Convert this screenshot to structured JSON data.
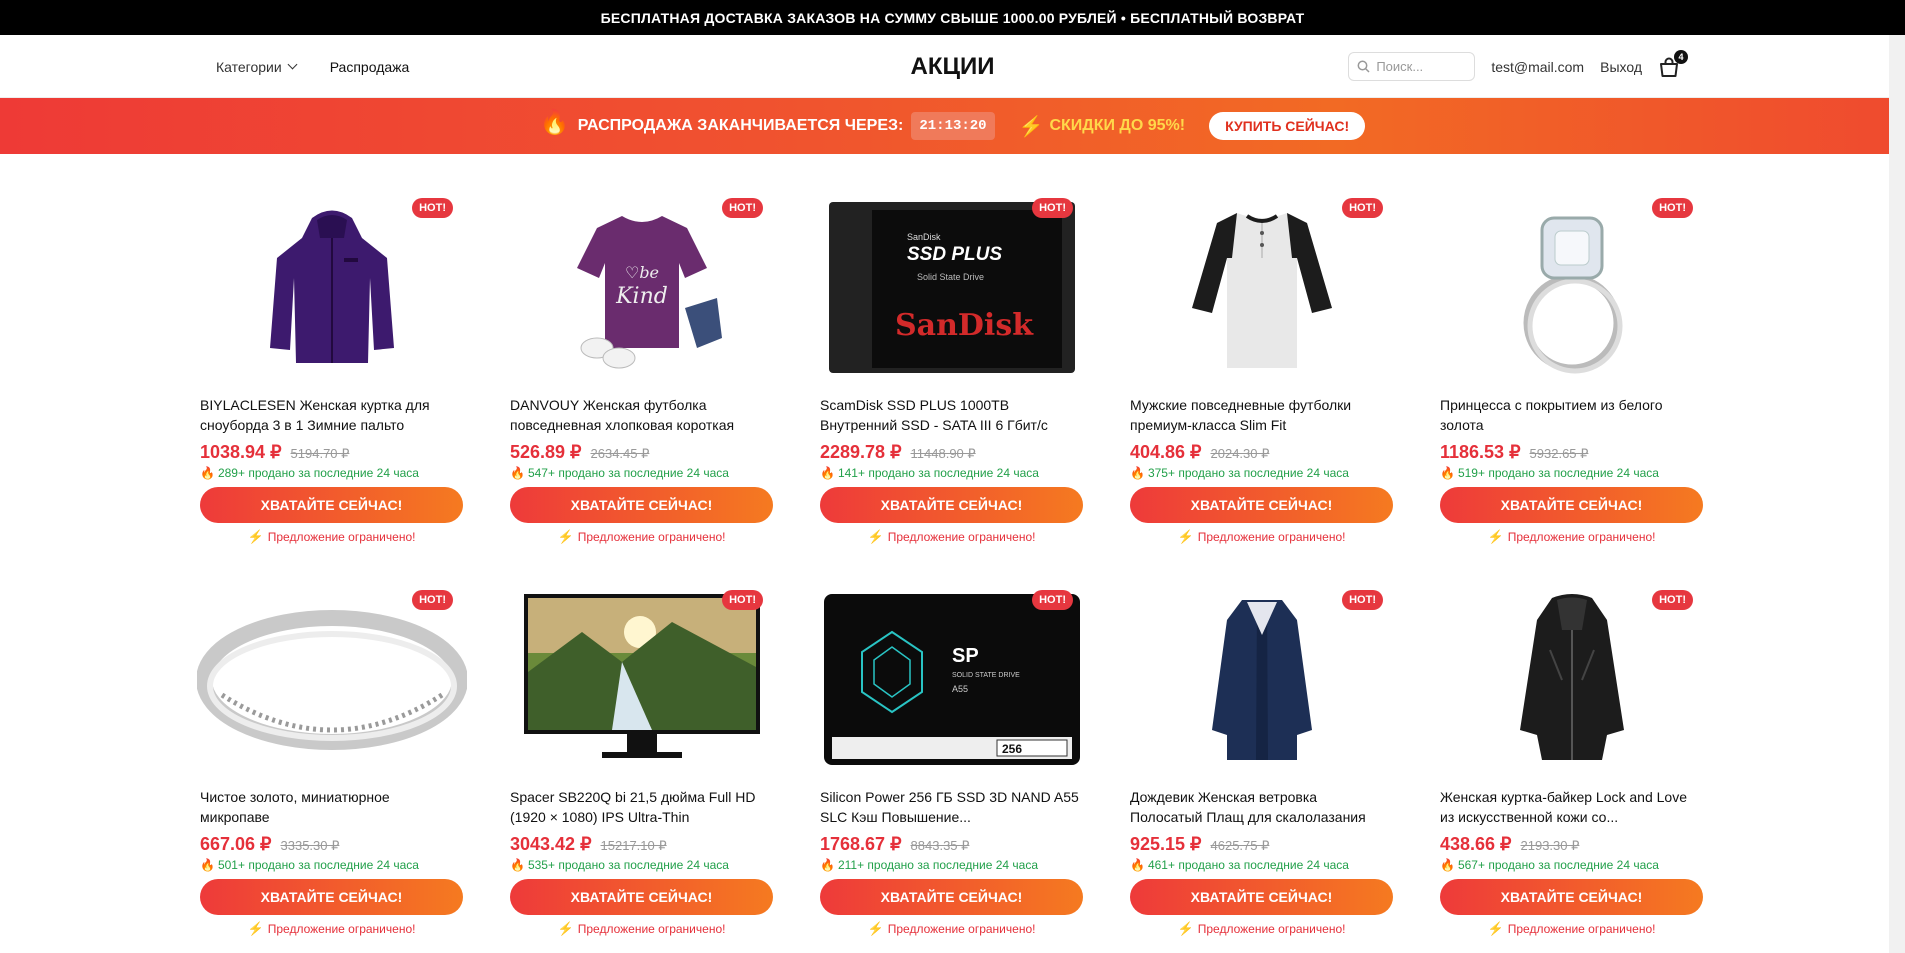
{
  "topbar": {
    "text": "БЕСПЛАТНАЯ ДОСТАВКА ЗАКАЗОВ НА СУММУ СВЫШЕ 1000.00 РУБЛЕЙ • БЕСПЛАТНЫЙ ВОЗВРАТ"
  },
  "header": {
    "categories_label": "Категории",
    "sale_label": "Распродажа",
    "title": "АКЦИИ",
    "search_placeholder": "Поиск...",
    "user_email": "test@mail.com",
    "logout_label": "Выход",
    "cart_count": "4"
  },
  "promo": {
    "fire_icon": "🔥",
    "ends_label": "РАСПРОДАЖА ЗАКАНЧИВАЕТСЯ ЧЕРЕЗ:",
    "timer": "21:13:20",
    "bolt_icon": "⚡",
    "discount_label": "СКИДКИ ДО 95%!",
    "buy_label": "КУПИТЬ СЕЙЧАС!"
  },
  "labels": {
    "hot": "HOT!",
    "grab": "ХВАТАЙТЕ СЕЙЧАС!",
    "limited": "Предложение ограничено!"
  },
  "colors": {
    "accent_red": "#e5303a",
    "accent_orange": "#f57a20",
    "sold_green": "#22a04a"
  },
  "products": [
    {
      "name": "BIYLACLESEN Женская куртка для сноуборда 3 в 1 Зимние пальто",
      "price": "1038.94 ₽",
      "old_price": "5194.70 ₽",
      "sold": "289+ продано за последние 24 часа",
      "image": "purple-jacket"
    },
    {
      "name": "DANVOUY Женская футболка повседневная хлопковая короткая",
      "price": "526.89 ₽",
      "old_price": "2634.45 ₽",
      "sold": "547+ продано за последние 24 часа",
      "image": "purple-tshirt"
    },
    {
      "name": "ScamDisk SSD PLUS 1000TB Внутренний SSD - SATA III 6 Гбит/с",
      "price": "2289.78 ₽",
      "old_price": "11448.90 ₽",
      "sold": "141+ продано за последние 24 часа",
      "image": "sandisk-ssd"
    },
    {
      "name": "Мужские повседневные футболки премиум-класса Slim Fit",
      "price": "404.86 ₽",
      "old_price": "2024.30 ₽",
      "sold": "375+ продано за последние 24 часа",
      "image": "raglan-shirt"
    },
    {
      "name": "Принцесса с покрытием из белого золота",
      "price": "1186.53 ₽",
      "old_price": "5932.65 ₽",
      "sold": "519+ продано за последние 24 часа",
      "image": "diamond-ring"
    },
    {
      "name": "Чистое золото, миниатюрное микропаве",
      "price": "667.06 ₽",
      "old_price": "3335.30 ₽",
      "sold": "501+ продано за последние 24 часа",
      "image": "silver-band"
    },
    {
      "name": "Spacer SB220Q bi 21,5 дюйма Full HD (1920 × 1080) IPS Ultra-Thin",
      "price": "3043.42 ₽",
      "old_price": "15217.10 ₽",
      "sold": "535+ продано за последние 24 часа",
      "image": "monitor"
    },
    {
      "name": "Silicon Power 256 ГБ SSD 3D NAND A55 SLC Кэш Повышение...",
      "price": "1768.67 ₽",
      "old_price": "8843.35 ₽",
      "sold": "211+ продано за последние 24 часа",
      "image": "sp-ssd"
    },
    {
      "name": "Дождевик Женская ветровка Полосатый Плащ для скалолазания",
      "price": "925.15 ₽",
      "old_price": "4625.75 ₽",
      "sold": "461+ продано за последние 24 часа",
      "image": "navy-coat"
    },
    {
      "name": "Женская куртка-байкер Lock and Love из искусственной кожи со...",
      "price": "438.66 ₽",
      "old_price": "2193.30 ₽",
      "sold": "567+ продано за последние 24 часа",
      "image": "leather-jacket"
    }
  ],
  "ssd1": {
    "brand_top": "SanDisk",
    "model": "SSD PLUS",
    "sub": "Solid State Drive",
    "brand": "SanDisk"
  },
  "ssd2": {
    "logo": "SP",
    "line1": "SOLID STATE DRIVE",
    "model": "A55",
    "cap": "256"
  }
}
